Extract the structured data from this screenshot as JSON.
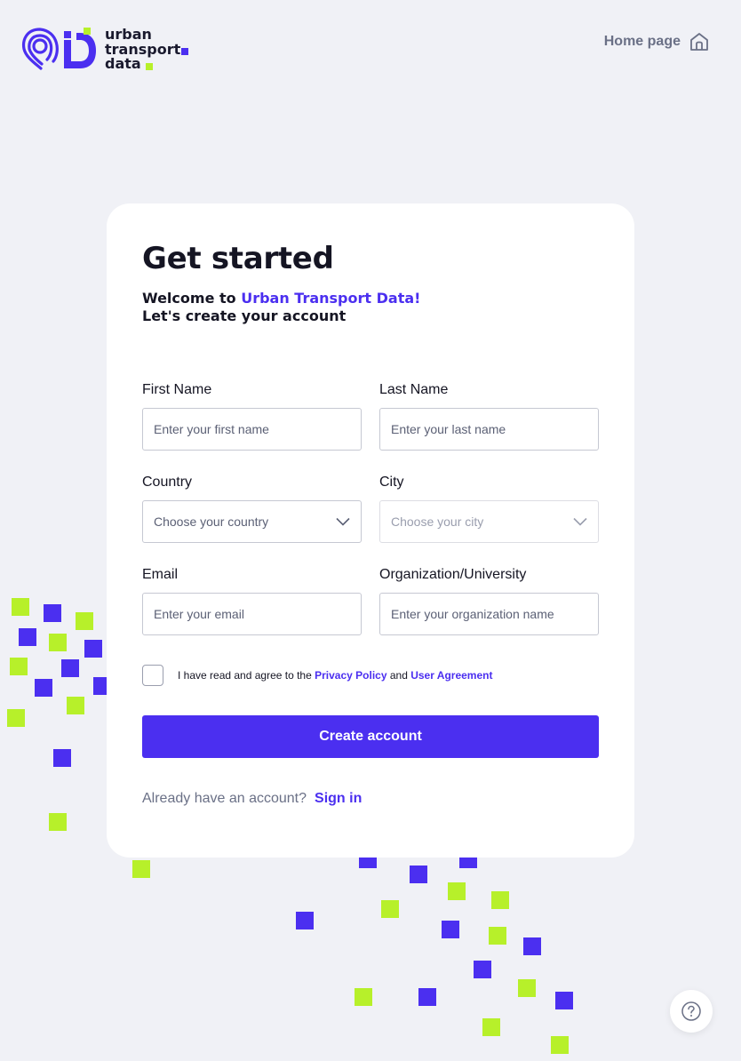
{
  "header": {
    "logo_lines": [
      "urban",
      "transport",
      "data"
    ],
    "home_label": "Home page"
  },
  "form": {
    "title": "Get started",
    "welcome_prefix": "Welcome to ",
    "welcome_brand": "Urban Transport Data!",
    "welcome_line2": "Let's create your account",
    "first_name": {
      "label": "First Name",
      "placeholder": "Enter your first name",
      "value": ""
    },
    "last_name": {
      "label": "Last Name",
      "placeholder": "Enter your last name",
      "value": ""
    },
    "country": {
      "label": "Country",
      "placeholder": "Choose your country"
    },
    "city": {
      "label": "City",
      "placeholder": "Choose your city",
      "disabled": true
    },
    "email": {
      "label": "Email",
      "placeholder": "Enter your email",
      "value": ""
    },
    "organization": {
      "label": "Organization/University",
      "placeholder": "Enter your organization name",
      "value": ""
    },
    "agree_prefix": "I have read and agree to the ",
    "privacy_link": "Privacy Policy",
    "agree_and": " and ",
    "agreement_link": "User Agreement",
    "agree_checked": false,
    "submit_label": "Create account",
    "signin_prompt": "Already have an account?",
    "signin_link": "Sign in"
  },
  "colors": {
    "brand": "#4b2ff0",
    "accent_lime": "#b7f02a",
    "background": "#f0f1f6"
  },
  "icons": {
    "logo": "location-pin-logo-icon",
    "home": "home-icon",
    "dropdown": "chevron-down-icon",
    "help": "question-circle-icon"
  }
}
